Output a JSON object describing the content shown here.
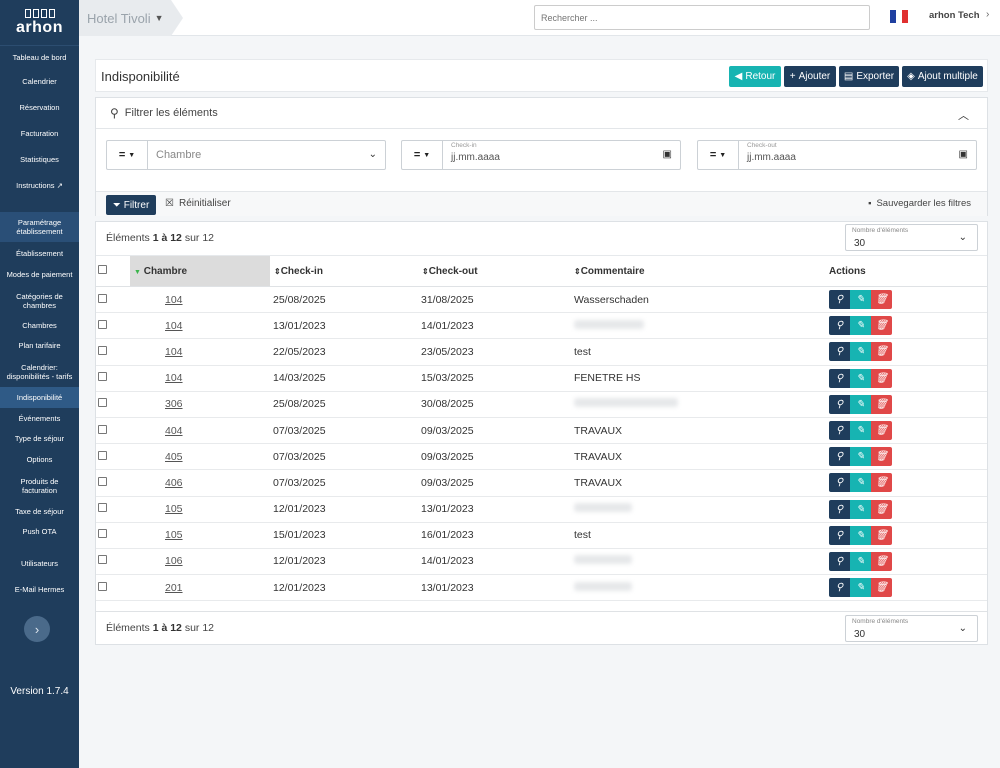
{
  "sidebar": {
    "logo_text": "arhon",
    "items": [
      {
        "label": "Tableau de bord",
        "h": 22
      },
      {
        "label": "Calendrier",
        "h": 26
      },
      {
        "label": "Réservation",
        "h": 26
      },
      {
        "label": "Facturation",
        "h": 26
      },
      {
        "label": "Statistiques",
        "h": 26
      },
      {
        "label": "Instructions ↗",
        "h": 26
      }
    ],
    "section_label": "Paramétrage établissement",
    "sub_items": [
      "Établissement",
      "Modes de paiement",
      "Catégories de chambres",
      "Chambres",
      "Plan tarifaire",
      "Calendrier: disponibilités - tarifs",
      "Indisponibilité",
      "Événements",
      "Type de séjour",
      "Options",
      "Produits de facturation",
      "Taxe de séjour",
      "Push OTA"
    ],
    "bottom_items": [
      "Utilisateurs",
      "E-Mail Hermes"
    ],
    "collapse_icon": "chevron-right-icon",
    "version": "Version 1.7.4"
  },
  "topbar": {
    "hotel": "Hotel Tivoli",
    "search_placeholder": "Rechercher ...",
    "flag_colors": [
      "#1f3fa0",
      "#ffffff",
      "#e03030"
    ],
    "user": "arhon Tech"
  },
  "header": {
    "title": "Indisponibilité",
    "buttons": {
      "back": "Retour",
      "add": "Ajouter",
      "export": "Exporter",
      "multi": "Ajout multiple"
    }
  },
  "filter": {
    "title": "Filtrer les éléments",
    "chambre_placeholder": "Chambre",
    "checkin_label": "Check-in",
    "checkout_label": "Check-out",
    "date_placeholder": "jj.mm.aaaa",
    "operator": "=",
    "filter_button": "Filtrer",
    "reset": "Réinitialiser",
    "save": "Sauvegarder les filtres"
  },
  "table": {
    "count_prefix": "Éléments",
    "count_range": "1 à 12",
    "count_suffix": "sur 12",
    "per_page_label": "Nombre d'éléments",
    "per_page_value": "30",
    "columns": {
      "room": "Chambre",
      "checkin": "Check-in",
      "checkout": "Check-out",
      "comment": "Commentaire",
      "actions": "Actions"
    },
    "rows": [
      {
        "room": "104",
        "checkin": "25/08/2025",
        "checkout": "31/08/2025",
        "comment": "Wasserschaden"
      },
      {
        "room": "104",
        "checkin": "13/01/2023",
        "checkout": "14/01/2023",
        "comment": ""
      },
      {
        "room": "104",
        "checkin": "22/05/2023",
        "checkout": "23/05/2023",
        "comment": "test"
      },
      {
        "room": "104",
        "checkin": "14/03/2025",
        "checkout": "15/03/2025",
        "comment": "FENETRE HS"
      },
      {
        "room": "306",
        "checkin": "25/08/2025",
        "checkout": "30/08/2025",
        "comment": ""
      },
      {
        "room": "404",
        "checkin": "07/03/2025",
        "checkout": "09/03/2025",
        "comment": "TRAVAUX"
      },
      {
        "room": "405",
        "checkin": "07/03/2025",
        "checkout": "09/03/2025",
        "comment": "TRAVAUX"
      },
      {
        "room": "406",
        "checkin": "07/03/2025",
        "checkout": "09/03/2025",
        "comment": "TRAVAUX"
      },
      {
        "room": "105",
        "checkin": "12/01/2023",
        "checkout": "13/01/2023",
        "comment": ""
      },
      {
        "room": "105",
        "checkin": "15/01/2023",
        "checkout": "16/01/2023",
        "comment": "test"
      },
      {
        "room": "106",
        "checkin": "12/01/2023",
        "checkout": "14/01/2023",
        "comment": ""
      },
      {
        "room": "201",
        "checkin": "12/01/2023",
        "checkout": "13/01/2023",
        "comment": ""
      }
    ]
  }
}
